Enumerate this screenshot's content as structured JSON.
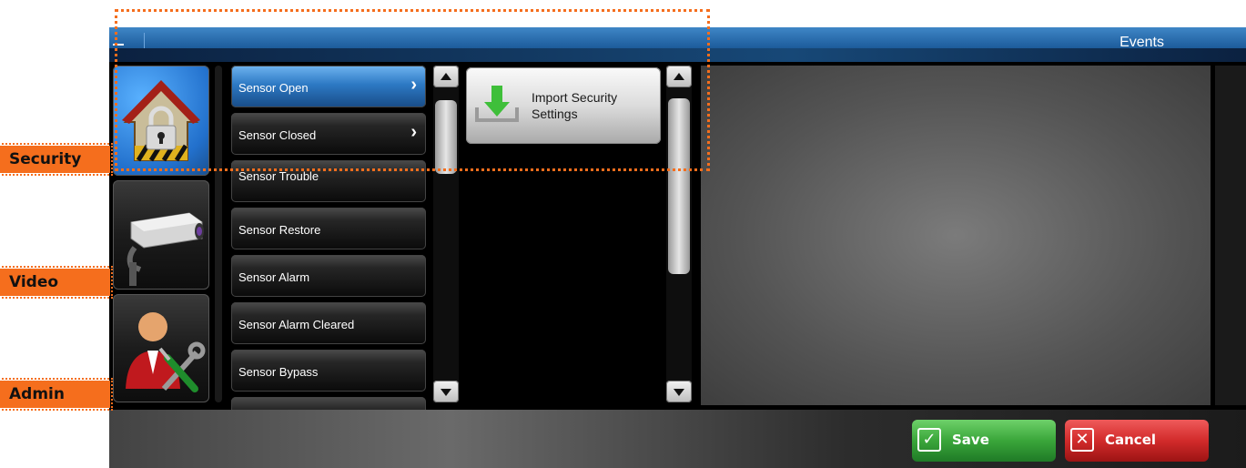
{
  "window": {
    "title": "Events"
  },
  "categories": [
    {
      "name": "Security",
      "icon": "house-lock-icon"
    },
    {
      "name": "Video",
      "icon": "security-camera-icon"
    },
    {
      "name": "Admin",
      "icon": "admin-tools-icon"
    }
  ],
  "events": [
    {
      "label": "Sensor Open",
      "selected": true,
      "has_submenu": true
    },
    {
      "label": "Sensor Closed",
      "selected": false,
      "has_submenu": true
    },
    {
      "label": "Sensor Trouble",
      "selected": false,
      "has_submenu": false
    },
    {
      "label": "Sensor Restore",
      "selected": false,
      "has_submenu": false
    },
    {
      "label": "Sensor Alarm",
      "selected": false,
      "has_submenu": false
    },
    {
      "label": "Sensor Alarm Cleared",
      "selected": false,
      "has_submenu": false
    },
    {
      "label": "Sensor Bypass",
      "selected": false,
      "has_submenu": false
    },
    {
      "label": "",
      "selected": false,
      "has_submenu": false
    }
  ],
  "actions": [
    {
      "label": "Import Security Settings",
      "icon": "import-download-icon"
    }
  ],
  "footer": {
    "save_label": "Save",
    "cancel_label": "Cancel"
  },
  "colors": {
    "accent_blue": "#2d79c4",
    "annotation_orange": "#f56e1d",
    "save_green": "#3aa63a",
    "cancel_red": "#d22b2b"
  },
  "scroll": {
    "events_thumb_fraction": 0.25,
    "actions_thumb_fraction": 0.6
  }
}
